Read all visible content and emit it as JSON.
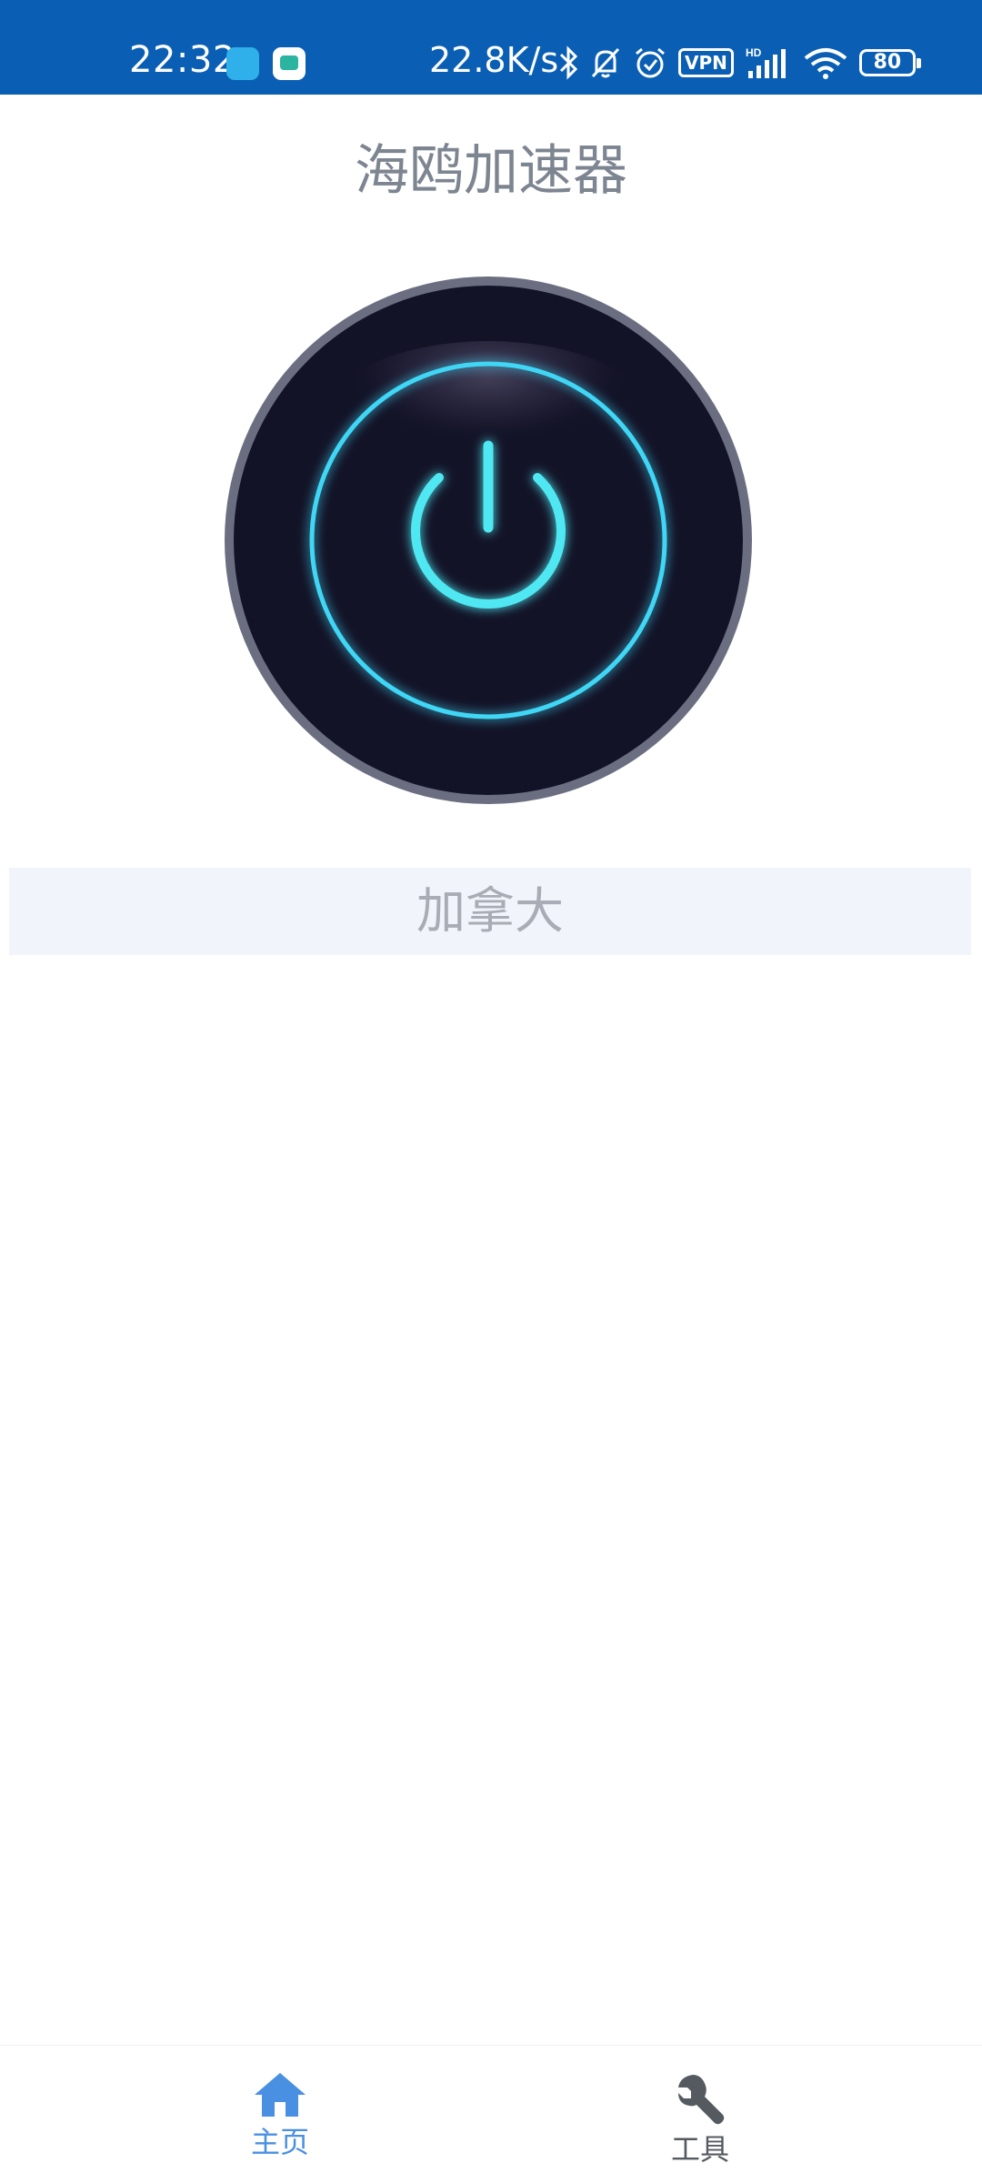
{
  "status_bar": {
    "time": "22:32",
    "network_speed": "22.8K/s",
    "vpn_label": "VPN",
    "signal_tag": "HD",
    "battery_level": "80",
    "icons": [
      "bird-app-icon",
      "tv-app-icon",
      "bluetooth-icon",
      "bell-off-icon",
      "alarm-icon",
      "vpn-icon",
      "signal-icon",
      "wifi-icon",
      "battery-icon"
    ]
  },
  "header": {
    "title": "海鸥加速器"
  },
  "power_button": {
    "icon": "power-icon",
    "ring_color": "#3fd6f5",
    "body_color": "#131327",
    "rim_color": "#6b6e80"
  },
  "location": {
    "label": "加拿大"
  },
  "bottom_nav": {
    "items": [
      {
        "label": "主页",
        "icon": "home-icon",
        "active": true,
        "color": "#4a90e2"
      },
      {
        "label": "工具",
        "icon": "wrench-icon",
        "active": false,
        "color": "#555a61"
      }
    ]
  }
}
